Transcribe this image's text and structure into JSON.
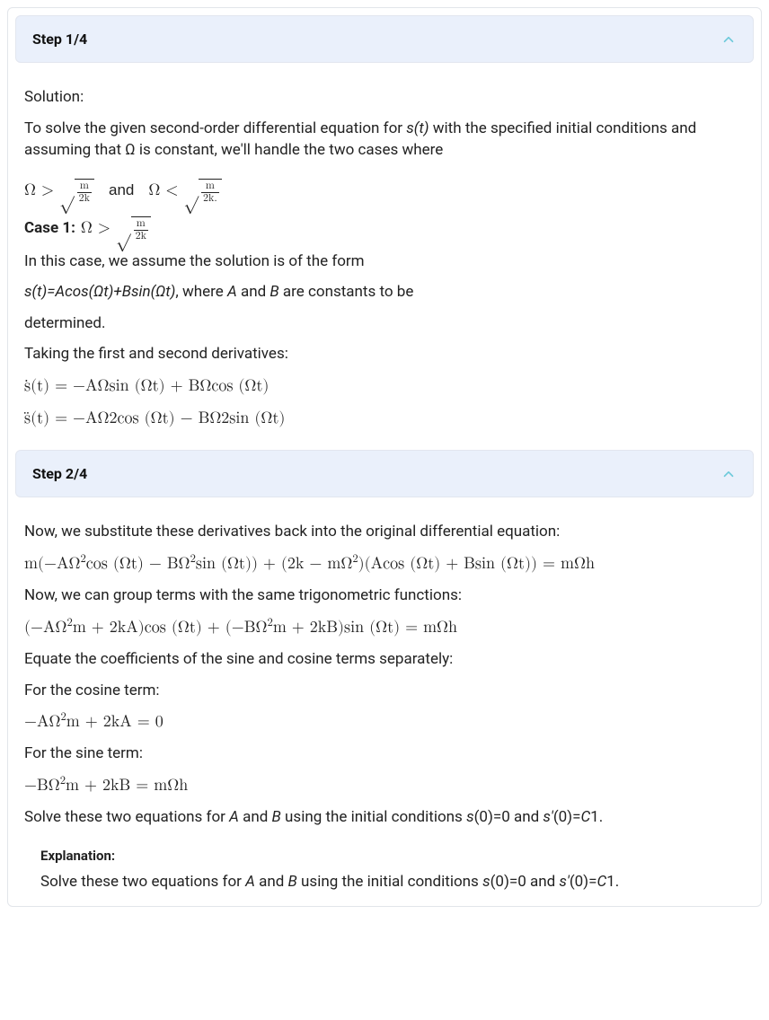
{
  "step1": {
    "header": "Step 1/4",
    "intro1": "Solution:",
    "intro2_prefix": "To solve the given second-order differential equation for ",
    "intro2_var": "s(t)",
    "intro2_mid": " with the specified initial conditions and assuming that Ω is constant, we'll handle the two cases where",
    "cond_and": "and",
    "case1_label": "Case 1:",
    "frac_m": "m",
    "frac_2k": "2k",
    "frac_2k_dot": "2k.",
    "assume": "In this case, we assume the solution is of the form",
    "form_eq_pre": "s(t)=Acos(Ωt)+Bsin(Ωt)",
    "form_eq_mid": ", where ",
    "form_eq_A": "A",
    "form_eq_and": " and ",
    "form_eq_B": "B",
    "form_eq_post": " are constants to be",
    "determined": "determined.",
    "taking": "Taking the first and second derivatives:",
    "deriv1": "ṡ(t) = −AΩsin (Ωt) + BΩcos (Ωt)",
    "deriv2": "s̈(t) = −AΩ2cos (Ωt) − BΩ2sin (Ωt)"
  },
  "step2": {
    "header": "Step 2/4",
    "sub_intro": "Now, we substitute these derivatives back into the original differential equation:",
    "eq1_a": "m(−AΩ",
    "eq1_b": "cos (Ωt) − BΩ",
    "eq1_c": "sin (Ωt)) + (2k − mΩ",
    "eq1_d": ")(Acos (Ωt) + Bsin (Ωt)) = mΩh",
    "group": "Now, we can group terms with the same trigonometric functions:",
    "eq2_a": "(−AΩ",
    "eq2_b": "m + 2kA)cos (Ωt) + (−BΩ",
    "eq2_c": "m + 2kB)sin (Ωt) = mΩh",
    "equate": "Equate the coefficients of the sine and cosine terms separately:",
    "forcos": "For the cosine term:",
    "eqcos_a": "−AΩ",
    "eqcos_b": "m + 2kA = 0",
    "forsin": "For the sine term:",
    "eqsin_a": "−BΩ",
    "eqsin_b": "m + 2kB = mΩh",
    "solve_pre": "Solve these two equations for ",
    "solve_A": "A",
    "solve_and": " and ",
    "solve_B": "B",
    "solve_mid": " using the initial conditions ",
    "solve_ic1": "s",
    "solve_ic1b": "(0)=0 and ",
    "solve_ic2": "s'",
    "solve_ic2b": "(0)=",
    "solve_C1": "C",
    "solve_end": "1.",
    "expl_label": "Explanation:",
    "sq2": "2"
  }
}
